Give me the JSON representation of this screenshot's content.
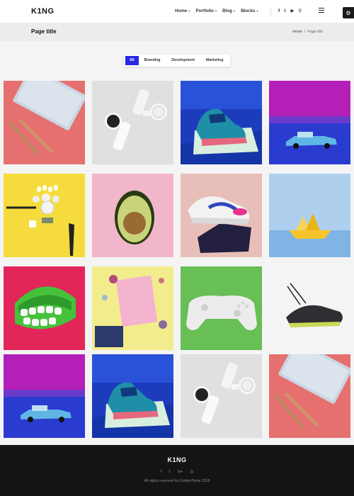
{
  "header": {
    "logo": "K1NG",
    "nav": [
      {
        "label": "Home",
        "caret": "▾"
      },
      {
        "label": "Portfolio",
        "caret": "▾"
      },
      {
        "label": "Blog",
        "caret": "▾"
      },
      {
        "label": "Blocks",
        "caret": "▾"
      }
    ],
    "social": [
      {
        "glyph": "f",
        "icon": "facebook-icon"
      },
      {
        "glyph": "𝕥",
        "icon": "twitter-icon"
      },
      {
        "glyph": "▶",
        "icon": "youtube-icon"
      },
      {
        "glyph": "⚲",
        "icon": "search-icon"
      }
    ],
    "settings_glyph": "⚙"
  },
  "titlebar": {
    "title": "Page title",
    "breadcrumb_home": "Home",
    "breadcrumb_sep": "/",
    "breadcrumb_current": "Page title"
  },
  "filters": {
    "items": [
      "All",
      "Branding",
      "Development",
      "Marketing"
    ],
    "active_index": 0,
    "accent": "#2727e6"
  },
  "gallery": {
    "tiles": [
      {
        "subject": "notebook-pencils"
      },
      {
        "subject": "white-watch"
      },
      {
        "subject": "blue-sneaker"
      },
      {
        "subject": "toy-car-magenta"
      },
      {
        "subject": "yellow-cutlery"
      },
      {
        "subject": "avocado"
      },
      {
        "subject": "pink-sneaker"
      },
      {
        "subject": "paper-boat"
      },
      {
        "subject": "wind-up-teeth"
      },
      {
        "subject": "pink-notebook"
      },
      {
        "subject": "white-gamepad"
      },
      {
        "subject": "black-sneaker"
      },
      {
        "subject": "toy-car-magenta"
      },
      {
        "subject": "blue-sneaker"
      },
      {
        "subject": "white-watch"
      },
      {
        "subject": "notebook-pencils"
      }
    ]
  },
  "footer": {
    "logo": "K1NG",
    "social": [
      {
        "glyph": "f",
        "icon": "facebook-icon"
      },
      {
        "glyph": "𝕥",
        "icon": "twitter-icon"
      },
      {
        "glyph": "G+",
        "icon": "google-plus-icon"
      },
      {
        "glyph": "◎",
        "icon": "instagram-icon"
      }
    ],
    "copyright": "All rights reserved for GoldenTemp 2018"
  }
}
